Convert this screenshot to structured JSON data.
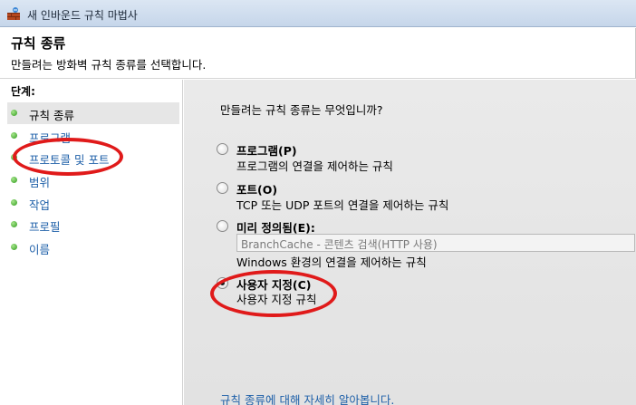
{
  "window": {
    "title": "새 인바운드 규칙 마법사"
  },
  "header": {
    "title": "규칙 종류",
    "description": "만들려는 방화벽 규칙 종류를 선택합니다."
  },
  "sidebar": {
    "steps_label": "단계:",
    "items": [
      {
        "label": "규칙 종류",
        "active": true
      },
      {
        "label": "프로그램",
        "active": false
      },
      {
        "label": "프로토콜 및 포트",
        "active": false
      },
      {
        "label": "범위",
        "active": false
      },
      {
        "label": "작업",
        "active": false
      },
      {
        "label": "프로필",
        "active": false
      },
      {
        "label": "이름",
        "active": false
      }
    ]
  },
  "main": {
    "question": "만들려는 규칙 종류는 무엇입니까?",
    "options": [
      {
        "label": "프로그램(P)",
        "description": "프로그램의 연결을 제어하는 규칙",
        "checked": false
      },
      {
        "label": "포트(O)",
        "description": "TCP 또는 UDP 포트의 연결을 제어하는 규칙",
        "checked": false
      },
      {
        "label": "미리 정의됨(E):",
        "combo_value": "BranchCache - 콘텐츠 검색(HTTP 사용)",
        "description": "Windows 환경의 연결을 제어하는 규칙",
        "checked": false
      },
      {
        "label": "사용자 지정(C)",
        "description": "사용자 지정 규칙",
        "checked": true
      }
    ],
    "learn_more_link": "규칙 종류에 대해 자세히 알아봅니다."
  },
  "annotations": {
    "color": "#e01a1a"
  }
}
